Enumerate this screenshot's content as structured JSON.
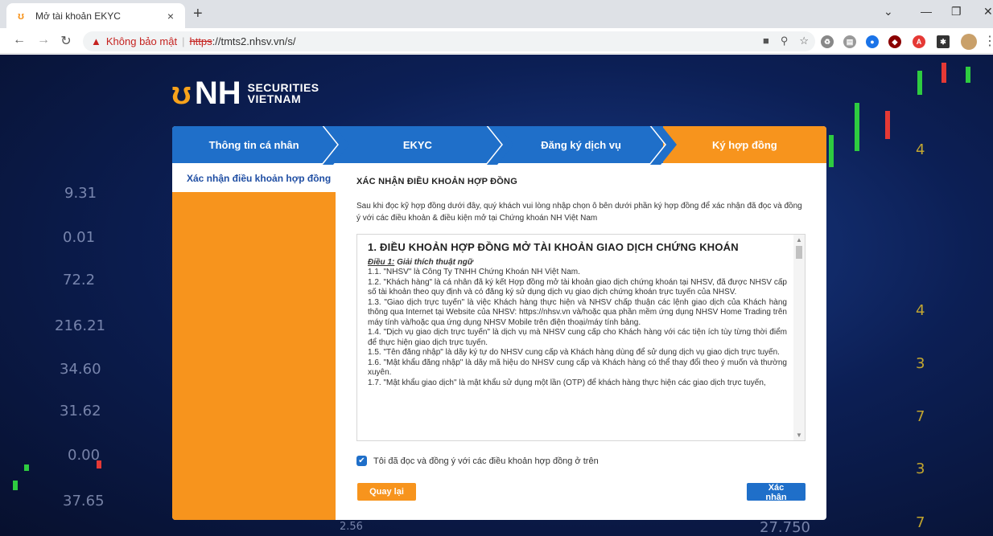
{
  "browser": {
    "tab_title": "Mở tài khoản EKYC",
    "tab_favicon": "NH",
    "new_tab": "+",
    "close_tab": "×",
    "security_label": "Không bảo mật",
    "url_scheme": "https",
    "url_rest": "://tmts2.nhsv.vn/s/",
    "minimize": "—",
    "restore": "❐",
    "close": "✕",
    "dropdown": "⌄"
  },
  "logo": {
    "nh": "NH",
    "line1": "SECURITIES",
    "line2": "VIETNAM"
  },
  "background_numbers": {
    "left": [
      "9.31",
      "0.01",
      "72.2",
      "216.21",
      "34.60",
      "31.62",
      "0.00",
      "37.65"
    ],
    "right": [
      "4",
      "4",
      "3",
      "7",
      "3",
      "7"
    ],
    "bottom": [
      "2.56",
      "27.750"
    ]
  },
  "steps": [
    "Thông tin cá nhân",
    "EKYC",
    "Đăng ký dịch vụ",
    "Ký hợp đồng"
  ],
  "active_step": 3,
  "sidebar": {
    "item": "Xác nhận điều khoản hợp đồng"
  },
  "content": {
    "title": "XÁC NHẬN ĐIỀU KHOẢN HỢP ĐỒNG",
    "intro": "Sau khi đọc kỹ hợp đồng dưới đây, quý khách vui lòng nhập chọn ô bên dưới phần ký hợp đồng để xác nhận đã đọc và đồng ý với các điều khoản & điều kiện mở tại Chứng khoán NH Việt Nam",
    "terms_heading": "1. ĐIỀU KHOẢN HỢP ĐỒNG MỞ TÀI KHOẢN GIAO DỊCH CHỨNG KHOÁN",
    "article_label": "Điều 1:",
    "article_title": " Giải thích thuật ngữ",
    "clauses": [
      "1.1.  \"NHSV\" là Công Ty TNHH Chứng Khoán NH Việt Nam.",
      "1.2.  \"Khách hàng\" là cá nhân đã ký kết Hợp đồng mở tài khoản giao dịch chứng khoán tại NHSV, đã được NHSV cấp số tài khoản theo quy định và có đăng ký sử dụng dịch vụ giao dịch chứng khoán trực tuyến của NHSV.",
      "1.3.  \"Giao dịch trực tuyến\" là việc Khách hàng thực hiện và NHSV chấp thuận các lệnh giao dịch của Khách hàng thông qua Internet tại Website của NHSV: https://nhsv.vn và/hoặc qua phần mềm ứng dụng NHSV Home Trading trên máy tính và/hoặc qua ứng dụng NHSV Mobile trên điện thoại/máy tính bảng.",
      "1.4.  \"Dịch vụ giao dịch trực tuyến\" là dịch vụ mà NHSV cung cấp cho Khách hàng với các tiện ích tùy từng thời điểm để thực hiện giao dịch trực tuyến.",
      "1.5.  \"Tên đăng nhập\" là dãy ký tự do NHSV cung cấp và Khách hàng dùng để sử dụng dịch vụ giao dịch trực tuyến.",
      "1.6.  \"Mật khẩu đăng nhập\" là dãy mã hiệu do NHSV cung cấp và Khách hàng có thể thay đổi theo ý muốn và thường xuyên.",
      "1.7.  \"Mật khẩu giao dịch\" là mật khẩu sử dụng một lần (OTP) để khách hàng thực hiện các giao dịch trực tuyến,"
    ],
    "agree_label": "Tôi đã đọc và đồng ý với các điều khoản hợp đồng ở trên",
    "agree_checked": true
  },
  "buttons": {
    "back": "Quay lại",
    "confirm": "Xác nhận"
  },
  "colors": {
    "primary_blue": "#1f6fc9",
    "orange": "#f7941d",
    "bg_navy": "#0c1f55"
  }
}
